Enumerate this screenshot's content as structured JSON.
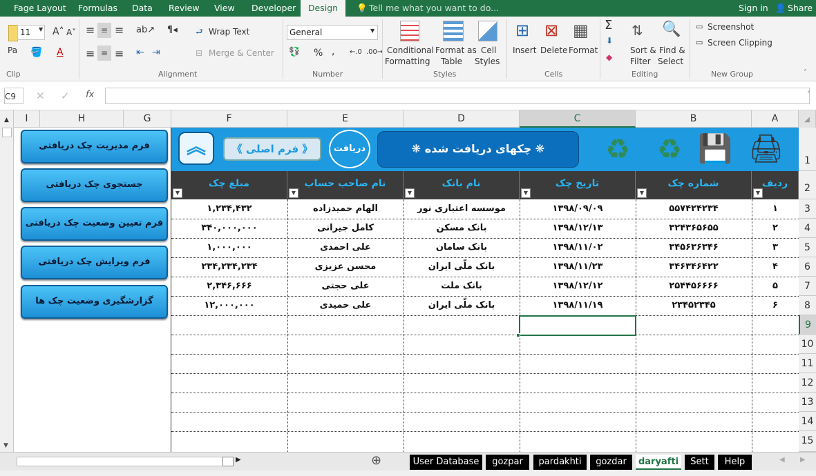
{
  "menu": {
    "items": [
      "Fage Layout",
      "Formulas",
      "Data",
      "Review",
      "View",
      "Developer",
      "Design"
    ],
    "tell_me": "Tell me what you want to do...",
    "sign_in": "Sign in",
    "share": "Share"
  },
  "ribbon": {
    "font_size": "11",
    "paste_label": "Pa",
    "clipboard_label": "Clip",
    "wrap_text": "Wrap Text",
    "merge_center": "Merge & Center",
    "alignment_label": "Alignment",
    "number_format": "General",
    "number_label": "Number",
    "conditional": [
      "Conditional",
      "Formatting"
    ],
    "format_table": [
      "Format as",
      "Table"
    ],
    "cell_styles": [
      "Cell",
      "Styles"
    ],
    "styles_label": "Styles",
    "insert": "Insert",
    "delete": "Delete",
    "format": "Format",
    "cells_label": "Cells",
    "sort": [
      "Sort &",
      "Filter"
    ],
    "find": [
      "Find &",
      "Select"
    ],
    "editing_label": "Editing",
    "screenshot": "Screenshot",
    "screen_clipping": "Screen Clipping",
    "new_group_label": "New Group"
  },
  "formula_bar": {
    "name_box": "C9",
    "fx": "fx",
    "value": ""
  },
  "columns": [
    "I",
    "H",
    "G",
    "F",
    "E",
    "D",
    "C",
    "B",
    "A"
  ],
  "rows": [
    "1",
    "2",
    "3",
    "4",
    "5",
    "6",
    "7",
    "8",
    "9",
    "10",
    "11",
    "12",
    "13",
    "14",
    "15"
  ],
  "banner": {
    "title": "❋ چکهای دریافت شده ❋",
    "main_form": "《 فرم اصلی 》",
    "badge": "دریافت"
  },
  "table": {
    "headers": [
      "مبلغ چک",
      "نام صاحب حساب",
      "نام بانک",
      "تاریخ چک",
      "شماره چک",
      "ردیف"
    ],
    "rows": [
      [
        "۱,۲۳۴,۴۳۲",
        "الهام حمیدزاده",
        "موسسه اعتباری نور",
        "۱۳۹۸/۰۹/۰۹",
        "۵۵۷۴۲۴۲۳۴",
        "۱"
      ],
      [
        "۳۴۰,۰۰۰,۰۰۰",
        "کامل جیرانی",
        "بانک مسکن",
        "۱۳۹۸/۱۲/۱۳",
        "۳۲۴۳۶۵۶۵۵",
        "۲"
      ],
      [
        "۱,۰۰۰,۰۰۰",
        "علی احمدی",
        "بانک سامان",
        "۱۳۹۸/۱۱/۰۲",
        "۳۴۵۶۳۶۳۴۶",
        "۳"
      ],
      [
        "۲۳۴,۲۳۴,۲۳۴",
        "محسن عزیزی",
        "بانک ملّی ایران",
        "۱۳۹۸/۱۱/۲۳",
        "۳۴۶۳۴۶۴۲۲",
        "۴"
      ],
      [
        "۲,۳۴۶,۶۶۶",
        "علی حجتی",
        "بانک ملت",
        "۱۳۹۸/۱۲/۱۲",
        "۲۵۴۴۵۶۶۶۶",
        "۵"
      ],
      [
        "۱۲,۰۰۰,۰۰۰",
        "علی حمیدی",
        "بانک ملّی ایران",
        "۱۳۹۸/۱۱/۱۹",
        "۲۳۴۵۲۳۴۵",
        "۶"
      ]
    ]
  },
  "side_buttons": [
    "فرم مدیریت چک دریافتی",
    "جستجوی چک دریافتی",
    "فرم تعیین وضعیت چک دریافتی",
    "فرم ویرایش چک دریافتی",
    "گزارشگیری وضعیت چک ها"
  ],
  "sheets": [
    "User Database",
    "gozpar",
    "pardakhti",
    "gozdar",
    "daryafti",
    "Sett",
    "Help"
  ],
  "active_sheet": "daryafti",
  "colors": {
    "accent": "#217346",
    "banner": "#1e9ae0",
    "header": "#3b3b3b",
    "header_text": "#29b6f6"
  }
}
